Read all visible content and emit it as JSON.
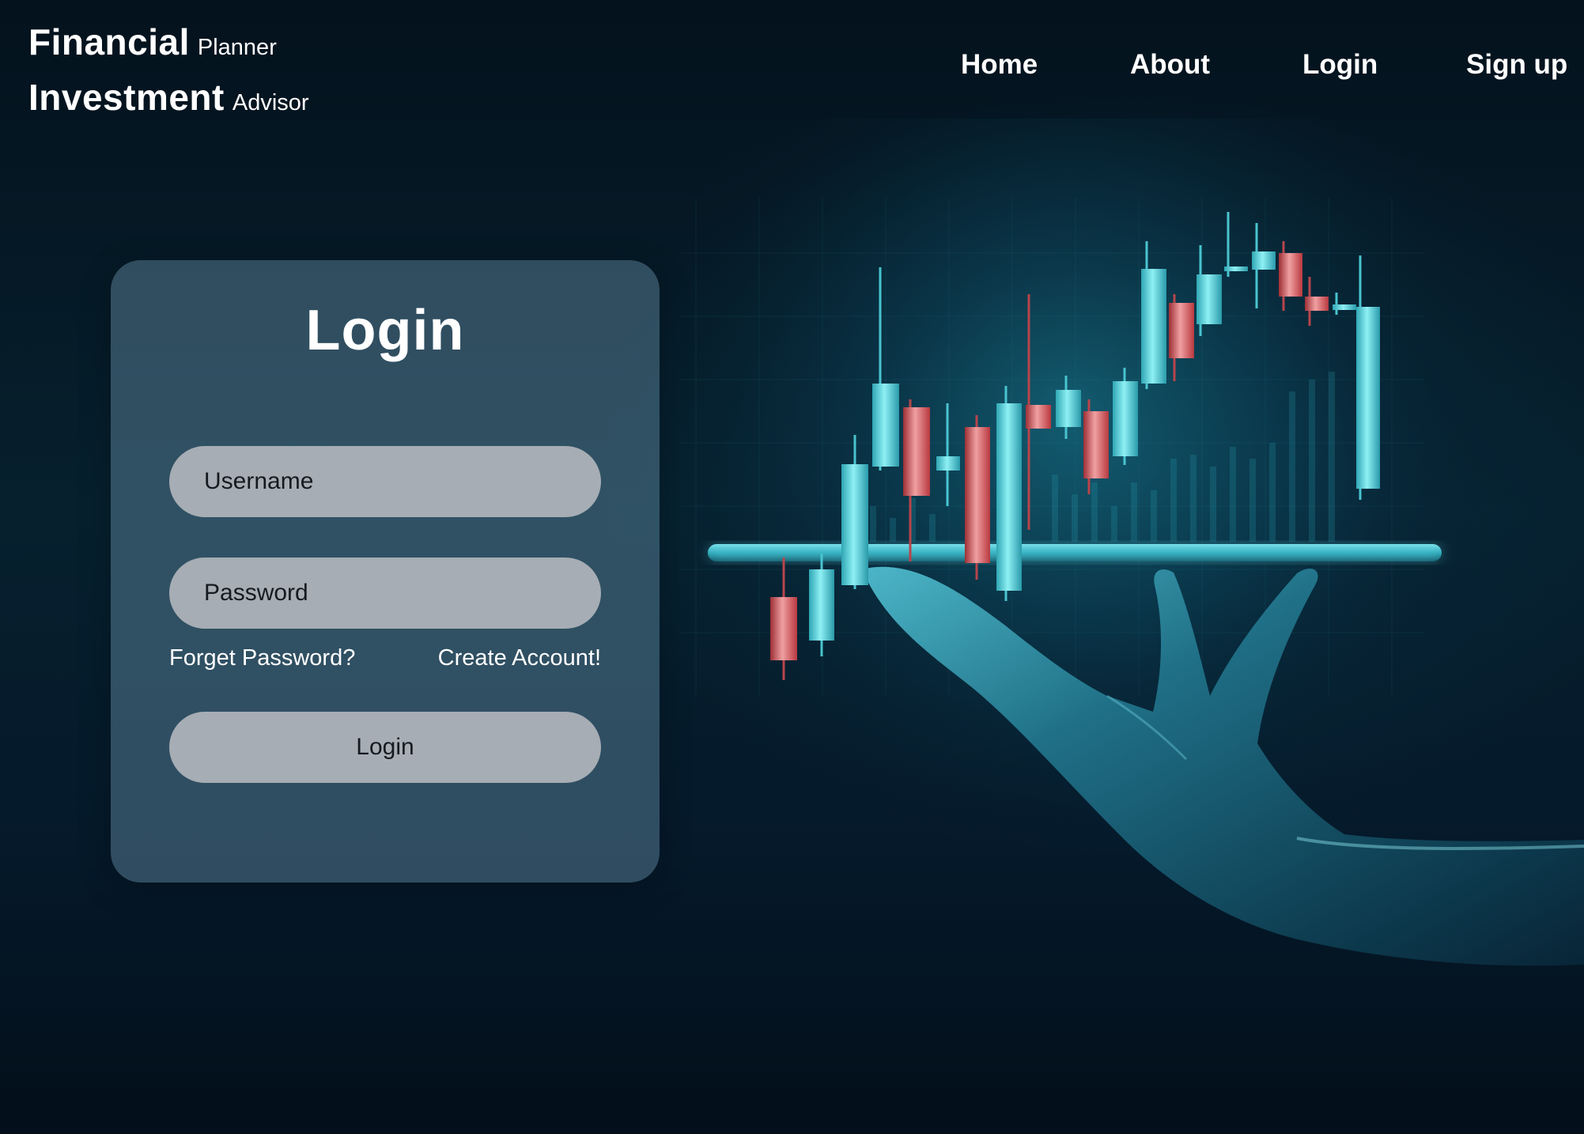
{
  "brand": {
    "line1_big": "Financial",
    "line1_small": "Planner",
    "line2_big": "Investment",
    "line2_small": "Advisor"
  },
  "nav": {
    "items": [
      {
        "label": "Home"
      },
      {
        "label": "About"
      },
      {
        "label": "Login"
      },
      {
        "label": "Sign up"
      }
    ]
  },
  "login_form": {
    "title": "Login",
    "username": {
      "placeholder": "Username",
      "value": ""
    },
    "password": {
      "placeholder": "Password",
      "value": ""
    },
    "forgot_link": "Forget Password?",
    "create_link": "Create Account!",
    "submit_label": "Login"
  },
  "hero": {
    "description_icon": "candlestick-chart-on-hand",
    "colors": {
      "up_candle": "#5fd3dc",
      "down_candle": "#d3565a",
      "glow": "#1fb6c8",
      "background": "#041420"
    }
  }
}
